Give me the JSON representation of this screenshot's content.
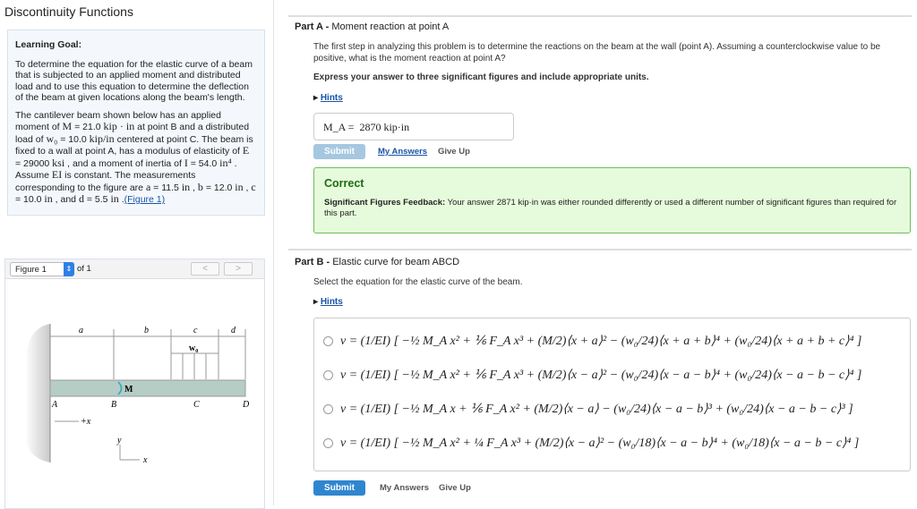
{
  "page_title": "Discontinuity Functions",
  "learning_goal": {
    "heading": "Learning Goal:",
    "p1": "To determine the equation for the elastic curve of a beam that is subjected to an applied moment and distributed load and to use this equation to determine the deflection of the beam at given locations along the beam's length.",
    "p2_parts": [
      "The cantilever beam shown below has an applied moment of ",
      "M",
      " = 21.0 ",
      "kip · in",
      " at point B and a distributed load of ",
      "w₀",
      " = 10.0 ",
      "kip/in",
      " centered at point C. The beam is fixed to a wall at point A, has a modulus of elasticity of ",
      "E",
      " = 29000 ",
      "ksi",
      " , and a moment of inertia of ",
      "I",
      " = 54.0 ",
      "in⁴",
      " . Assume ",
      "EI",
      " is constant. The measurements corresponding to the figure are ",
      "a",
      " = 11.5 ",
      "in",
      " , ",
      "b",
      " = 12.0 ",
      "in",
      " , ",
      "c",
      " = 10.0 ",
      "in",
      " , and ",
      "d",
      " = 5.5 ",
      "in",
      " ."
    ],
    "figure_link": "(Figure 1)"
  },
  "figure": {
    "select": "Figure 1",
    "of": "of 1",
    "prev": "<",
    "next": ">",
    "labels": {
      "a": "a",
      "b": "b",
      "c": "c",
      "d": "d",
      "w0": "w₀",
      "M": "M",
      "A": "A",
      "B": "B",
      "C": "C",
      "D": "D",
      "plusx": "+x",
      "y": "y",
      "x": "x"
    }
  },
  "partA": {
    "label": "Part A -",
    "title": "Moment reaction at point A",
    "prompt": "The first step in analyzing this problem is to determine the reactions on the beam at the wall (point A). Assuming a counterclockwise value to be positive, what is the moment reaction at point A?",
    "instruction": "Express your answer to three significant figures and include appropriate units.",
    "hints": "Hints",
    "answer_label": "M_A =",
    "answer_value": "2870 kip·in",
    "submit": "Submit",
    "my_answers": "My Answers",
    "give_up": "Give Up",
    "feedback_title": "Correct",
    "feedback_bold": "Significant Figures Feedback:",
    "feedback_text": " Your answer 2871 kip·in was either rounded differently or used a different number of significant figures than required for this part."
  },
  "partB": {
    "label": "Part B -",
    "title": "Elastic curve for beam ABCD",
    "prompt": "Select the equation for the elastic curve of the beam.",
    "hints": "Hints",
    "options": [
      "v = (1/EI) [ −½ M_A x² + ⅙ F_A x³ + (M/2)⟨x + a⟩² − (w₀/24)⟨x + a + b⟩⁴ + (w₀/24)⟨x + a + b + c⟩⁴ ]",
      "v = (1/EI) [ −½ M_A x² + ⅙ F_A x³ + (M/2)⟨x − a⟩² − (w₀/24)⟨x − a − b⟩⁴ + (w₀/24)⟨x − a − b − c⟩⁴ ]",
      "v = (1/EI) [ −½ M_A x + ⅙ F_A x² + (M/2)⟨x − a⟩ − (w₀/24)⟨x − a − b⟩³ + (w₀/24)⟨x − a − b − c⟩³ ]",
      "v = (1/EI) [ −½ M_A x² + ¼ F_A x³ + (M/2)⟨x − a⟩² − (w₀/18)⟨x − a − b⟩⁴ + (w₀/18)⟨x − a − b − c⟩⁴ ]"
    ],
    "submit": "Submit",
    "my_answers": "My Answers",
    "give_up": "Give Up"
  }
}
